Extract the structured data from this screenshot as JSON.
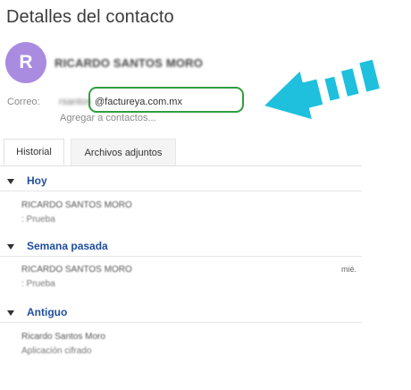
{
  "header": {
    "title": "Detalles del contacto"
  },
  "contact": {
    "initial": "R",
    "name": "RICARDO SANTOS MORO",
    "email_label": "Correo:",
    "email_user": "rsantos",
    "email_domain": "@factureya.com.mx",
    "add_contact_link": "Agregar a contactos..."
  },
  "tabs": [
    {
      "label": "Historial",
      "active": true
    },
    {
      "label": "Archivos adjuntos",
      "active": false
    }
  ],
  "sections": [
    {
      "label": "Hoy",
      "items": [
        {
          "sender": "RICARDO SANTOS MORO",
          "subject": ": Prueba",
          "date": ""
        }
      ]
    },
    {
      "label": "Semana pasada",
      "items": [
        {
          "sender": "RICARDO SANTOS MORO",
          "subject": ": Prueba",
          "date": "mié."
        }
      ]
    },
    {
      "label": "Antiguo",
      "items": [
        {
          "sender": "Ricardo Santos Moro",
          "subject": "Aplicación cifrado",
          "date": ""
        }
      ]
    }
  ],
  "colors": {
    "avatar": "#a98ce0",
    "highlight_box": "#2f9e3f",
    "arrow_fill": "#1ec0dd",
    "section_label": "#1f4e9e"
  },
  "icons": {
    "annotation": "arrow-pointer-icon",
    "collapse": "triangle-down-icon"
  }
}
